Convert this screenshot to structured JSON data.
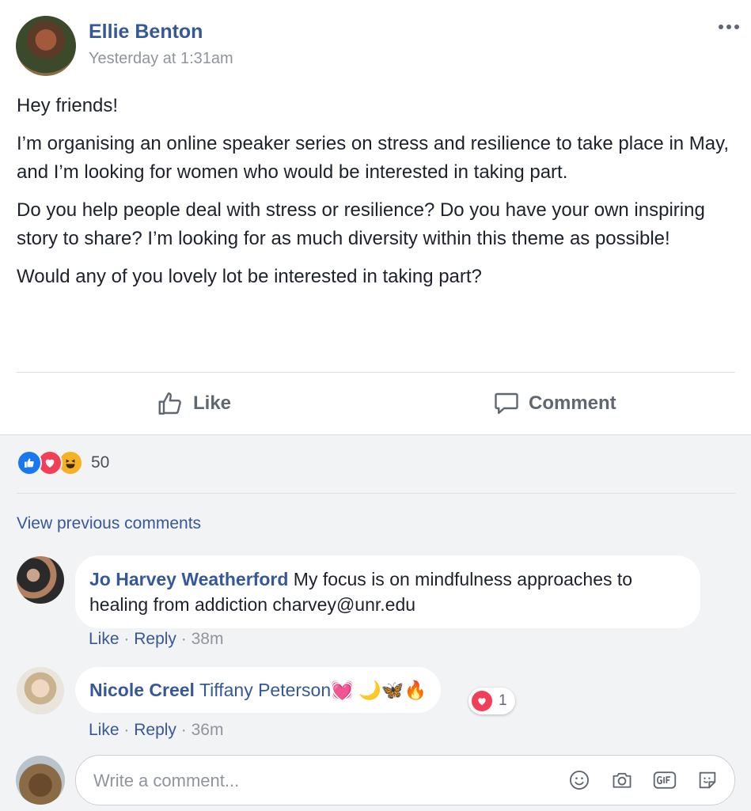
{
  "post": {
    "author": "Ellie Benton",
    "timestamp": "Yesterday at 1:31am",
    "paragraphs": [
      "Hey friends!",
      "I’m organising an online speaker series on stress and resilience to take place in May, and I’m looking for women who would be interested in taking part.",
      "Do you help people deal with stress or resilience? Do you have your own inspiring story to share? I’m looking for as much diversity within this theme as possible!",
      "Would any of you lovely lot be interested in taking part?"
    ],
    "actions": {
      "like": "Like",
      "comment": "Comment"
    },
    "reactions": {
      "icons": [
        "like-icon",
        "love-icon",
        "haha-icon"
      ],
      "count": "50"
    }
  },
  "comments_section": {
    "view_previous": "View previous comments",
    "comments": [
      {
        "author": "Jo Harvey Weatherford",
        "text": "My focus is on mindfulness approaches to healing from addiction charvey@unr.edu",
        "like": "Like",
        "sep": "·",
        "reply": "Reply",
        "time": "38m"
      },
      {
        "author": "Nicole Creel",
        "mention": "Tiffany Peterson",
        "emojis": [
          "💓",
          "🌙",
          "🦋",
          "🔥"
        ],
        "reaction_count": "1",
        "like": "Like",
        "sep": "·",
        "reply": "Reply",
        "time": "36m"
      }
    ],
    "composer": {
      "placeholder": "Write a comment...",
      "tools": [
        "emoji-icon",
        "camera-icon",
        "gif-icon",
        "sticker-icon"
      ]
    }
  },
  "colors": {
    "link": "#365899",
    "secondary_text": "#90949c",
    "comment_bg": "#f2f3f5",
    "love": "#f33e58",
    "like": "#1877f2"
  }
}
